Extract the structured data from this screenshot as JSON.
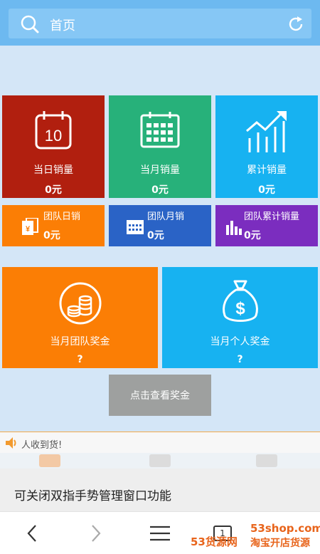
{
  "header": {
    "search_text": "首页"
  },
  "tiles": {
    "daily": {
      "label": "当日销量",
      "value": "0元",
      "color": "#b11f0f"
    },
    "monthly": {
      "label": "当月销量",
      "value": "0元",
      "color": "#27b17a"
    },
    "cumulative": {
      "label": "累计销量",
      "value": "0元",
      "color": "#17b2f1"
    },
    "team_daily": {
      "label": "团队日销",
      "value": "0元",
      "color": "#fb7e05"
    },
    "team_monthly": {
      "label": "团队月销",
      "value": "0元",
      "color": "#2a63c6"
    },
    "team_cumulative": {
      "label": "团队累计销量",
      "value": "0元",
      "color": "#7b2dbf"
    },
    "team_bonus": {
      "label": "当月团队奖金",
      "value": "?",
      "color": "#fb7e05"
    },
    "personal_bonus": {
      "label": "当月个人奖金",
      "value": "?",
      "color": "#17b2f1"
    },
    "calendar_day": "10"
  },
  "view_bonus_button": "点击查看奖金",
  "ticker": {
    "text": "人收到货!"
  },
  "toast": {
    "text": "可关闭双指手势管理窗口功能"
  },
  "navbar": {
    "back": "‹",
    "forward": "›",
    "tabs_count": "1"
  },
  "watermark": {
    "part1": "53货源网",
    "part2": "53shop.com",
    "part3": "淘宝开店货源"
  }
}
